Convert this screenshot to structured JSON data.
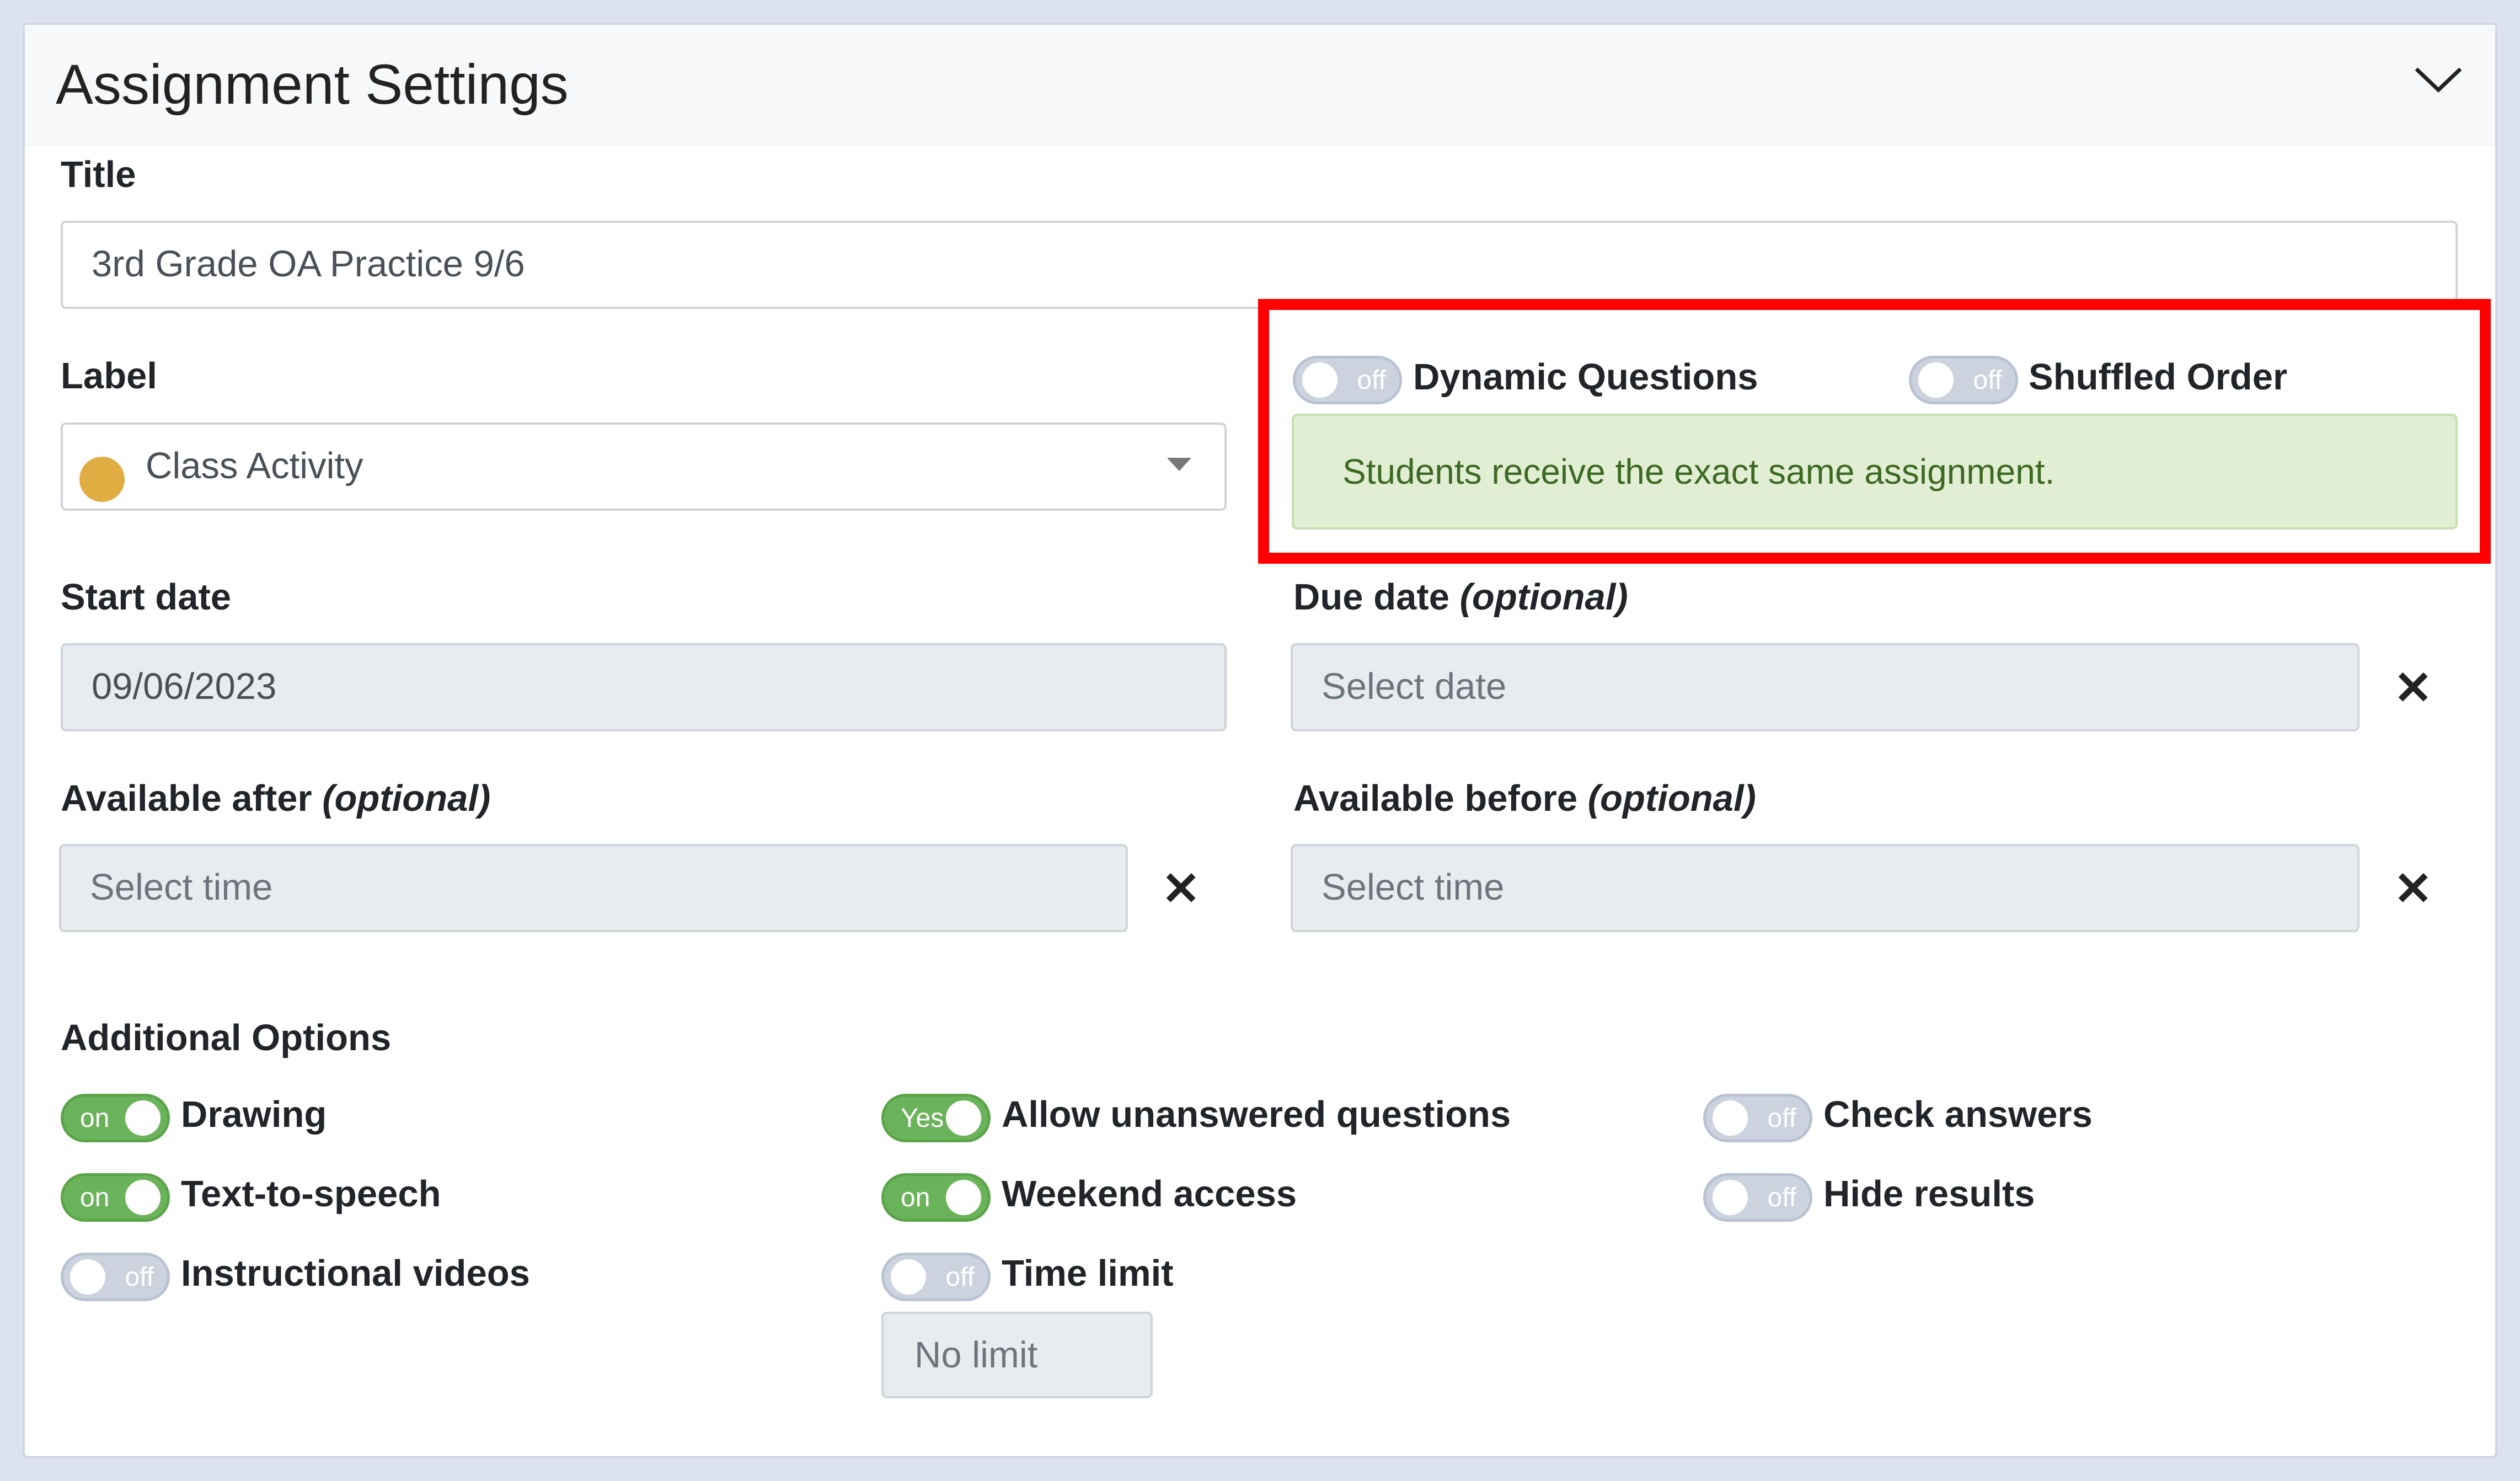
{
  "panel": {
    "title": "Assignment Settings",
    "collapse_icon": "chevron-down-icon"
  },
  "title_field": {
    "label": "Title",
    "value": "3rd Grade OA Practice 9/6"
  },
  "label_field": {
    "label": "Label",
    "value": "Class Activity",
    "dot_color": "#e0ad43"
  },
  "dynamic_questions": {
    "label": "Dynamic Questions",
    "state": "off"
  },
  "shuffled_order": {
    "label": "Shuffled Order",
    "state": "off"
  },
  "info_alert": {
    "text": "Students receive the exact same assignment."
  },
  "start_date": {
    "label": "Start date",
    "value": "09/06/2023"
  },
  "due_date": {
    "label": "Due date",
    "optional": "(optional)",
    "placeholder": "Select date"
  },
  "available_after": {
    "label": "Available after",
    "optional": "(optional)",
    "placeholder": "Select time"
  },
  "available_before": {
    "label": "Available before",
    "optional": "(optional)",
    "placeholder": "Select time"
  },
  "clear_symbol": "✕",
  "additional_options": {
    "heading": "Additional Options",
    "items": [
      {
        "label": "Drawing",
        "state": "on"
      },
      {
        "label": "Text-to-speech",
        "state": "on"
      },
      {
        "label": "Instructional videos",
        "state": "off"
      },
      {
        "label": "Allow unanswered questions",
        "state": "Yes"
      },
      {
        "label": "Weekend access",
        "state": "on"
      },
      {
        "label": "Time limit",
        "state": "off"
      },
      {
        "label": "Check answers",
        "state": "off"
      },
      {
        "label": "Hide results",
        "state": "off"
      }
    ],
    "time_limit_placeholder": "No limit"
  },
  "colors": {
    "toggle_on": "#6bb35a",
    "toggle_off": "#ccd3df",
    "alert_bg": "#e2eed3",
    "alert_text": "#3c6a22",
    "highlight": "#ff0000"
  }
}
